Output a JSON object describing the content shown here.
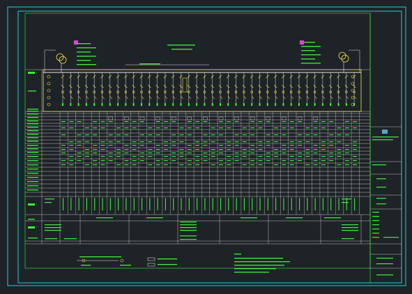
{
  "drawing": {
    "colors": {
      "background": "#1e2327",
      "border_outer": "#19d0d8",
      "border_inner": "#19d0d8",
      "line": "#e8e8e8",
      "text_green": "#3cf03c",
      "bus_yellow": "#f5e64a",
      "accent_magenta": "#d24ad2",
      "accent_cyan": "#19d0d8"
    },
    "center_title": "",
    "bus_label": "",
    "left_transformer_notes": [],
    "right_transformer_notes": [],
    "row_labels": [],
    "notes_title": "",
    "notes": [],
    "legend": [],
    "title_block": {
      "logo": "company-logo",
      "project_name": "",
      "drawing_name": "",
      "fields": []
    }
  }
}
